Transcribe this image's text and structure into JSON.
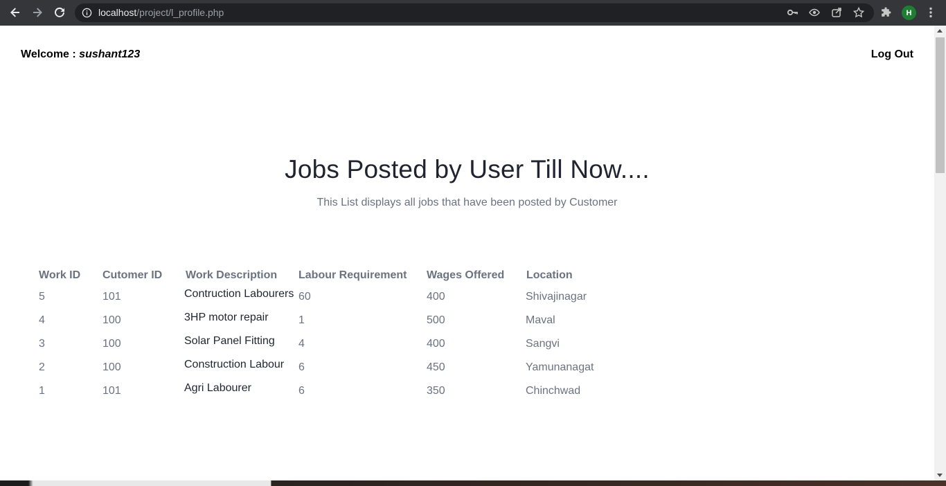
{
  "browser": {
    "url_host": "localhost",
    "url_path": "/project/l_profile.php",
    "profile_initial": "H"
  },
  "header": {
    "welcome_label": "Welcome : ",
    "username": "sushant123",
    "logout_label": "Log Out"
  },
  "main": {
    "title": "Jobs Posted by User Till Now....",
    "subtitle": "This List displays all jobs that have been posted by Customer"
  },
  "table": {
    "columns": [
      "Work ID",
      "Cutomer ID",
      "Work Description",
      "Labour Requirement",
      "Wages Offered",
      "Location"
    ],
    "rows": [
      [
        "5",
        "101",
        "Contruction Labourers",
        "60",
        "400",
        "Shivajinagar"
      ],
      [
        "4",
        "100",
        "3HP motor repair",
        "1",
        "500",
        "Maval"
      ],
      [
        "3",
        "100",
        "Solar Panel Fitting",
        "4",
        "400",
        "Sangvi"
      ],
      [
        "2",
        "100",
        "Construction Labour",
        "6",
        "450",
        "Yamunanagat"
      ],
      [
        "1",
        "101",
        "Agri Labourer",
        "6",
        "350",
        "Chinchwad"
      ]
    ]
  },
  "colors": {
    "chrome_bg": "#35363a",
    "omnibox_bg": "#202124",
    "text_muted": "#6b7280",
    "text_dark": "#1f2430"
  }
}
